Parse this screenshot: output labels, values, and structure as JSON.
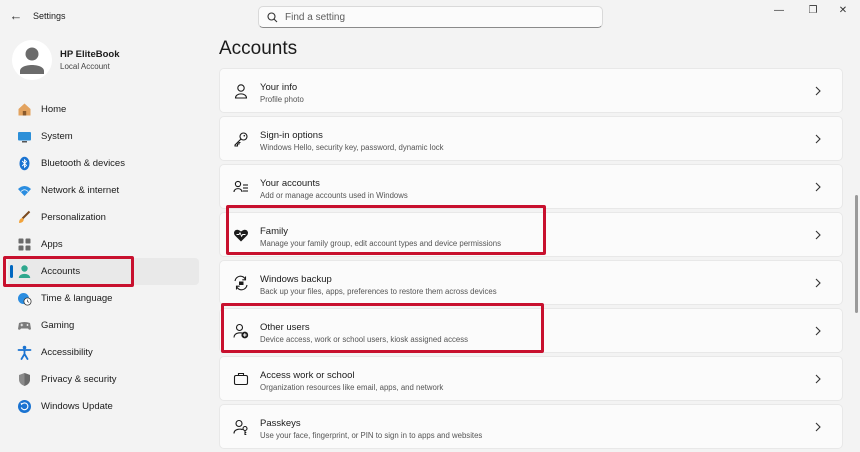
{
  "window": {
    "title": "Settings"
  },
  "search": {
    "placeholder": "Find a setting"
  },
  "profile": {
    "name": "HP EliteBook",
    "account_type": "Local Account"
  },
  "nav": [
    {
      "label": "Home",
      "icon": "home-icon"
    },
    {
      "label": "System",
      "icon": "system-icon"
    },
    {
      "label": "Bluetooth & devices",
      "icon": "bluetooth-icon"
    },
    {
      "label": "Network & internet",
      "icon": "wifi-icon"
    },
    {
      "label": "Personalization",
      "icon": "brush-icon"
    },
    {
      "label": "Apps",
      "icon": "apps-icon"
    },
    {
      "label": "Accounts",
      "icon": "person-icon",
      "selected": true
    },
    {
      "label": "Time & language",
      "icon": "clock-globe-icon"
    },
    {
      "label": "Gaming",
      "icon": "gamepad-icon"
    },
    {
      "label": "Accessibility",
      "icon": "accessibility-icon"
    },
    {
      "label": "Privacy & security",
      "icon": "shield-icon"
    },
    {
      "label": "Windows Update",
      "icon": "update-icon"
    }
  ],
  "page": {
    "title": "Accounts"
  },
  "cards": [
    {
      "title": "Your info",
      "subtitle": "Profile photo",
      "icon": "person-outline-icon"
    },
    {
      "title": "Sign-in options",
      "subtitle": "Windows Hello, security key, password, dynamic lock",
      "icon": "key-icon"
    },
    {
      "title": "Your accounts",
      "subtitle": "Add or manage accounts used in Windows",
      "icon": "person-list-icon"
    },
    {
      "title": "Family",
      "subtitle": "Manage your family group, edit account types and device permissions",
      "icon": "heart-icon",
      "highlighted": true
    },
    {
      "title": "Windows backup",
      "subtitle": "Back up your files, apps, preferences to restore them across devices",
      "icon": "backup-icon"
    },
    {
      "title": "Other users",
      "subtitle": "Device access, work or school users, kiosk assigned access",
      "icon": "person-add-icon",
      "highlighted": true
    },
    {
      "title": "Access work or school",
      "subtitle": "Organization resources like email, apps, and network",
      "icon": "briefcase-icon"
    },
    {
      "title": "Passkeys",
      "subtitle": "Use your face, fingerprint, or PIN to sign in to apps and websites",
      "icon": "passkey-icon"
    }
  ],
  "colors": {
    "accent": "#0067c0",
    "highlight_box": "#c8102e",
    "background": "#f3f3f3",
    "card": "#fbfbfb"
  }
}
